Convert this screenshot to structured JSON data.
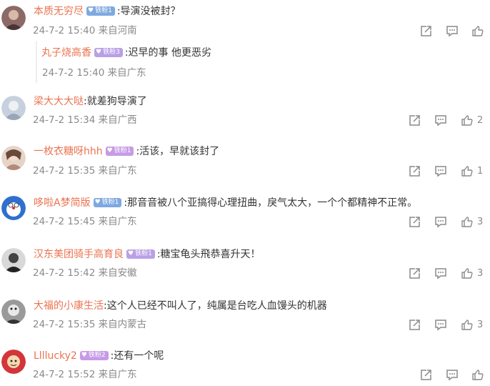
{
  "comments": [
    {
      "username": "本质无穷尽",
      "badge": "铁粉1",
      "badge_color": "#7ea9e0",
      "text": ":导演没被封？",
      "meta": "24-7-2 15:40 来自河南",
      "likes": "",
      "avatar_color": "#7a5c5a",
      "reply": {
        "username": "丸子烧高香",
        "badge": "铁粉3",
        "badge_color": "#b9a0e6",
        "text": ":迟早的事 他更恶劣",
        "meta": "24-7-2 15:40 来自广东"
      }
    },
    {
      "username": "梁大大大哒",
      "badge": "",
      "badge_color": "",
      "text": ":就差狗导演了",
      "meta": "24-7-2 15:34 来自广西",
      "likes": "2",
      "avatar_color": "#b9c3d2"
    },
    {
      "username": "一枚衣糖呀hhh",
      "badge": "铁粉1",
      "badge_color": "#c79ae6",
      "text": ":活该，早就该封了",
      "meta": "24-7-2 15:35 来自广东",
      "likes": "1",
      "avatar_color": "#c9a89a"
    },
    {
      "username": "哆啦A梦简版",
      "badge": "铁粉1",
      "badge_color": "#7ea9e0",
      "text": ":那音音被八个亚搞得心理扭曲，戾气太大，一个个都精神不正常。",
      "meta": "24-7-2 15:45 来自广东",
      "likes": "3",
      "avatar_color": "#2f6fd0"
    },
    {
      "username": "汉东美团骑手高育良",
      "badge": "铁粉1",
      "badge_color": "#b9a0e6",
      "text": ":糖宝龟头飛恭喜升天！",
      "meta": "24-7-2 15:42 来自安徽",
      "likes": "3",
      "avatar_color": "#555555"
    },
    {
      "username": "大福的小康生活",
      "badge": "",
      "badge_color": "",
      "text": ":这个人已经不叫人了，纯属是台吃人血馒头的机器",
      "meta": "24-7-2 15:35 来自内蒙古",
      "likes": "3",
      "avatar_color": "#6a6a6a"
    },
    {
      "username": "Llllucky2",
      "badge": "铁粉2",
      "badge_color": "#c79ae6",
      "text": ":还有一个呢",
      "meta": "24-7-2 15:52 来自广东",
      "likes": "",
      "avatar_color": "#d2353a"
    }
  ],
  "icons": {
    "share": "share-icon",
    "comment": "comment-icon",
    "like": "like-icon"
  }
}
